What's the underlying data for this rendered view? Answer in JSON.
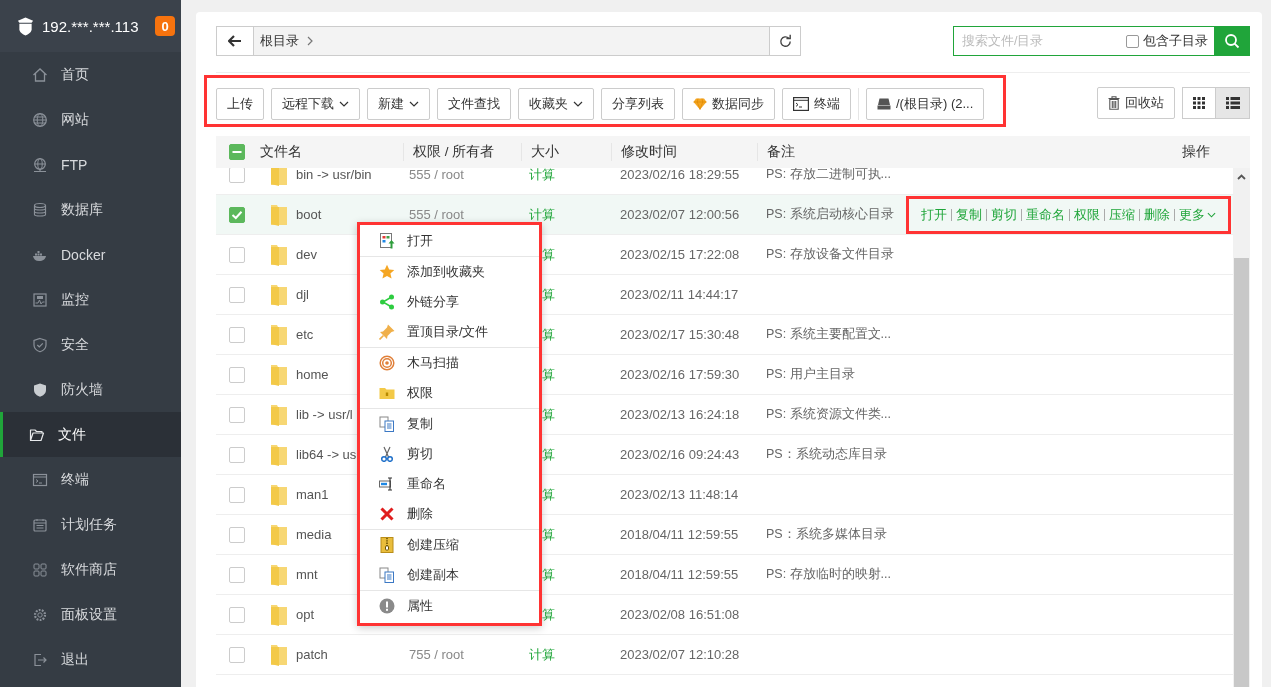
{
  "sidebar": {
    "host": "192.***.***.113",
    "badge": "0",
    "items": [
      {
        "label": "首页",
        "kind": "home",
        "selected": false
      },
      {
        "label": "网站",
        "kind": "globe",
        "selected": false
      },
      {
        "label": "FTP",
        "kind": "ftp",
        "selected": false
      },
      {
        "label": "数据库",
        "kind": "database",
        "selected": false
      },
      {
        "label": "Docker",
        "kind": "docker",
        "selected": false
      },
      {
        "label": "监控",
        "kind": "monitor",
        "selected": false
      },
      {
        "label": "安全",
        "kind": "shield-check",
        "selected": false
      },
      {
        "label": "防火墙",
        "kind": "shield",
        "selected": false
      },
      {
        "label": "文件",
        "kind": "folder",
        "selected": true
      },
      {
        "label": "终端",
        "kind": "terminal",
        "selected": false
      },
      {
        "label": "计划任务",
        "kind": "calendar",
        "selected": false
      },
      {
        "label": "软件商店",
        "kind": "apps",
        "selected": false
      },
      {
        "label": "面板设置",
        "kind": "gear",
        "selected": false
      },
      {
        "label": "退出",
        "kind": "logout",
        "selected": false
      }
    ]
  },
  "breadcrumb": {
    "segments": [
      "根目录"
    ]
  },
  "search": {
    "placeholder": "搜索文件/目录",
    "include_subdirs": {
      "label": "包含子目录",
      "checked": false
    }
  },
  "toolbar": [
    {
      "label": "上传",
      "kind": "plain"
    },
    {
      "label": "远程下载",
      "kind": "dropdown"
    },
    {
      "label": "新建",
      "kind": "dropdown"
    },
    {
      "label": "文件查找",
      "kind": "plain"
    },
    {
      "label": "收藏夹",
      "kind": "dropdown"
    },
    {
      "label": "分享列表",
      "kind": "plain"
    },
    {
      "label": "数据同步",
      "kind": "gem"
    },
    {
      "label": "终端",
      "kind": "terminal"
    },
    {
      "label": "/(根目录) (2...",
      "kind": "disk"
    }
  ],
  "recycle": {
    "label": "回收站"
  },
  "views": [
    {
      "kind": "grid",
      "selected": false
    },
    {
      "kind": "list",
      "selected": true
    }
  ],
  "table": {
    "select_all_partial": true,
    "columns": [
      "文件名",
      "权限 / 所有者",
      "大小",
      "修改时间",
      "备注",
      "操作"
    ],
    "rows": [
      {
        "name": "bin -> usr/bin",
        "perm": "555 / root",
        "size": "计算",
        "time": "2023/02/16 18:29:55",
        "note": "PS: 存放二进制可执...",
        "checked": false
      },
      {
        "name": "boot",
        "perm": "555 / root",
        "size": "计算",
        "time": "2023/02/07 12:00:56",
        "note": "PS: 系统启动核心目录",
        "checked": true,
        "actions": [
          "打开",
          "复制",
          "剪切",
          "重命名",
          "权限",
          "压缩",
          "删除",
          "更多"
        ]
      },
      {
        "name": "dev",
        "size": "算",
        "clipped": true,
        "time": "2023/02/15 17:22:08",
        "note": "PS: 存放设备文件目录",
        "checked": false
      },
      {
        "name": "djl",
        "size": "算",
        "clipped": true,
        "time": "2023/02/11 14:44:17",
        "checked": false
      },
      {
        "name": "etc",
        "size": "算",
        "clipped": true,
        "time": "2023/02/17 15:30:48",
        "note": "PS: 系统主要配置文...",
        "checked": false
      },
      {
        "name": "home",
        "size": "算",
        "clipped": true,
        "time": "2023/02/16 17:59:30",
        "note": "PS: 用户主目录",
        "checked": false
      },
      {
        "name": "lib -> usr/l",
        "size": "算",
        "clipped": true,
        "time": "2023/02/13 16:24:18",
        "note": "PS: 系统资源文件类...",
        "checked": false
      },
      {
        "name": "lib64 -> us",
        "size": "算",
        "clipped": true,
        "time": "2023/02/16 09:24:43",
        "note": "PS：系统动态库目录",
        "checked": false
      },
      {
        "name": "man1",
        "size": "算",
        "clipped": true,
        "time": "2023/02/13 11:48:14",
        "checked": false
      },
      {
        "name": "media",
        "size": "算",
        "clipped": true,
        "time": "2018/04/11 12:59:55",
        "note": "PS：系统多媒体目录",
        "checked": false
      },
      {
        "name": "mnt",
        "size": "算",
        "clipped": true,
        "time": "2018/04/11 12:59:55",
        "note": "PS: 存放临时的映射...",
        "checked": false
      },
      {
        "name": "opt",
        "size": "算",
        "clipped": true,
        "time": "2023/02/08 16:51:08",
        "checked": false
      },
      {
        "name": "patch",
        "perm": "755 / root",
        "size": "计算",
        "time": "2023/02/07 12:10:28",
        "checked": false
      }
    ]
  },
  "context_menu": {
    "groups": [
      [
        {
          "label": "打开",
          "kind": "open"
        }
      ],
      [
        {
          "label": "添加到收藏夹",
          "kind": "star"
        },
        {
          "label": "外链分享",
          "kind": "share"
        },
        {
          "label": "置顶目录/文件",
          "kind": "pin"
        }
      ],
      [
        {
          "label": "木马扫描",
          "kind": "scan"
        },
        {
          "label": "权限",
          "kind": "lock-folder"
        }
      ],
      [
        {
          "label": "复制",
          "kind": "copy"
        },
        {
          "label": "剪切",
          "kind": "cut"
        },
        {
          "label": "重命名",
          "kind": "rename"
        },
        {
          "label": "删除",
          "kind": "delete"
        }
      ],
      [
        {
          "label": "创建压缩",
          "kind": "zip"
        },
        {
          "label": "创建副本",
          "kind": "copy"
        }
      ],
      [
        {
          "label": "属性",
          "kind": "info"
        }
      ]
    ]
  }
}
